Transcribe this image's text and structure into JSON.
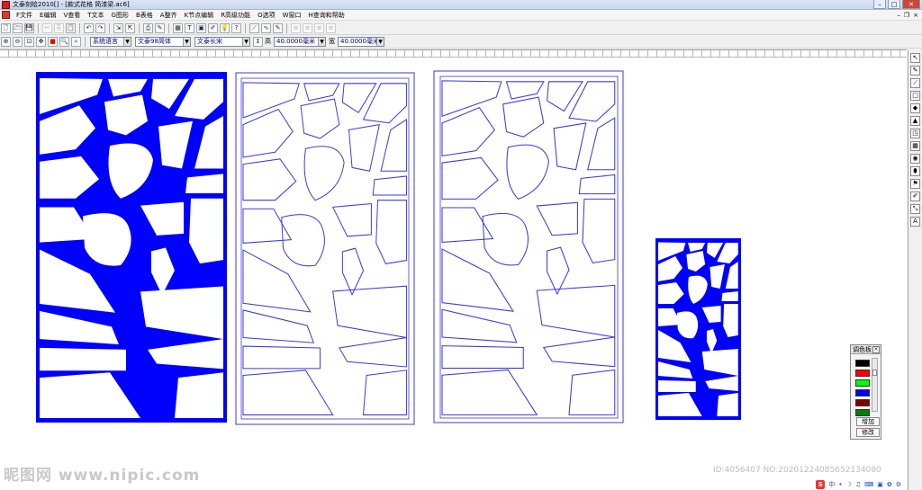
{
  "window": {
    "title": "文泰刻绘2010[] - [款式花格  简漆梁.ac6]",
    "controls": {
      "minimize": "–",
      "maximize": "□",
      "close": "✕"
    }
  },
  "menu": {
    "items": [
      "F文件",
      "E编辑",
      "V查看",
      "T文本",
      "G图形",
      "B表格",
      "A整齐",
      "K节点编辑",
      "R高级功能",
      "O选项",
      "W窗口",
      "H查询和帮助"
    ],
    "mdi_controls": {
      "minimize": "–",
      "restore": "❐",
      "close": "×"
    }
  },
  "toolbar1": {
    "icons": [
      "new-file-icon",
      "open-folder-icon",
      "save-icon",
      "cut-icon",
      "copy-icon",
      "paste-icon",
      "undo-icon",
      "redo-icon",
      "import-icon",
      "export-icon",
      "print-icon",
      "cutter-icon",
      "preview-icon",
      "text-icon",
      "image-icon",
      "pen-icon",
      "bulb-icon",
      "help-icon",
      "line-tool-icon",
      "bezier-tool-icon",
      "edit-icon",
      "align-left-icon",
      "align-center-icon",
      "align-right-icon",
      "align-justify-icon"
    ],
    "glyphs": [
      "🗋",
      "🗁",
      "💾",
      "✂",
      "⎘",
      "📋",
      "↶",
      "↷",
      "⇲",
      "⇱",
      "⎙",
      "✎",
      "▦",
      "T",
      "▣",
      "✐",
      "💡",
      "?",
      "⟋",
      "∿",
      "✎",
      "≡",
      "≡",
      "≡",
      "≡"
    ]
  },
  "toolbar2": {
    "icons": [
      "zoom-in-icon",
      "zoom-out-icon",
      "zoom-fit-icon",
      "pan-icon",
      "red-square-icon",
      "zoom-window-icon",
      "zoom-all-icon"
    ],
    "glyphs": [
      "⊕",
      "⊖",
      "⊡",
      "✥",
      "■",
      "🔍",
      "⌕"
    ],
    "language": "系统语言",
    "font_cn": "文泰98简体",
    "font_style": "文泰长宋",
    "height_label": "高",
    "height_value": "40.0000毫米",
    "width_label": "宽",
    "width_value": "40.0000毫米"
  },
  "right_tools": {
    "icons": [
      "select-arrow-icon",
      "node-tool-icon",
      "text-tool-icon",
      "rectangle-tool-icon",
      "fill-tool-icon",
      "outline-tool-icon",
      "shape-tool-icon",
      "table-tool-icon",
      "color-tool-icon",
      "paint-tool-icon",
      "flag-tool-icon",
      "brush-tool-icon",
      "resize-tool-icon",
      "font-tool-icon"
    ],
    "glyphs": [
      "↖",
      "✎",
      "⟋",
      "□",
      "◆",
      "▲",
      "◳",
      "▦",
      "◉",
      "⬮",
      "⚑",
      "✐",
      "⤡",
      "A"
    ]
  },
  "palette": {
    "title": "调色板",
    "close": "×",
    "colors": [
      "#000000",
      "#ff0000",
      "#00ff00",
      "#0000ff",
      "#800000",
      "#008000"
    ],
    "add_label": "增加",
    "edit_label": "修改"
  },
  "accent_blue": "#0000ff",
  "outline_blue": "#3a3ae0",
  "watermark": "昵图网 www.nipic.com",
  "image_id": "ID:4056407 NO:20201224085652134080",
  "status": {
    "ime": "S",
    "indicators": [
      "中",
      "•",
      "☽",
      "♫",
      "⌨",
      "▣",
      "✿",
      "⚙"
    ]
  }
}
